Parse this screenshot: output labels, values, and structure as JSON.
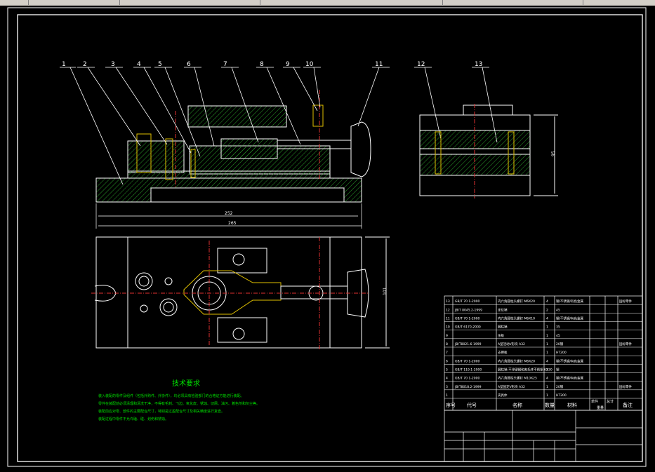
{
  "balloons": [
    "1",
    "2",
    "3",
    "4",
    "5",
    "6",
    "7",
    "8",
    "9",
    "10",
    "11",
    "12",
    "13"
  ],
  "dims": {
    "d1": "252",
    "d2": "265",
    "d3": "95",
    "d4": "101"
  },
  "notes": {
    "title": "技术要求",
    "lines": [
      "装入装配的零件及组件（包括外购件、外协件），均必须具有检验部门的合格证方能进行装配。",
      "零件在装配前必须清理和清洗干净，不得有毛刺、飞边、氧化皮、锈蚀、切屑、油污、着色剂和灰尘等。",
      "装配前应对零、部件的主要配合尺寸，特别是过盈配合尺寸及相关精度进行复查。",
      "装配过程中零件不允许磕、碰、划伤和锈蚀。"
    ]
  },
  "bom": {
    "rows": [
      {
        "seq": "13",
        "code": "GB/T 70 1-2000",
        "name": "内六角圆柱头螺钉 M6X20",
        "qty": "4",
        "mat": "钢/不锈钢/有色金属",
        "note": "国标零件"
      },
      {
        "seq": "12",
        "code": "JB/T 8045.2-1999",
        "name": "定位销",
        "qty": "2",
        "mat": "45",
        "note": ""
      },
      {
        "seq": "11",
        "code": "GB/T 70 1-2000",
        "name": "内六角圆柱头螺钉 M6X10",
        "qty": "4",
        "mat": "钢/不锈钢/有色金属",
        "note": ""
      },
      {
        "seq": "10",
        "code": "GB/T 6170-2000",
        "name": "圆柱销",
        "qty": "1",
        "mat": "35",
        "note": ""
      },
      {
        "seq": "9",
        "code": "",
        "name": "压板",
        "qty": "1",
        "mat": "45",
        "note": ""
      },
      {
        "seq": "8",
        "code": "JB/T8021.6-1999",
        "name": "A型活动V形块 A32",
        "qty": "1",
        "mat": "20钢",
        "note": "国标零件"
      },
      {
        "seq": "7",
        "code": "",
        "name": "支撑板",
        "qty": "1",
        "mat": "HT200",
        "note": ""
      },
      {
        "seq": "6",
        "code": "GB/T 70 1-2000",
        "name": "内六角圆柱头螺钉 M6X20",
        "qty": "4",
        "mat": "钢/不锈钢/有色金属",
        "note": ""
      },
      {
        "seq": "5",
        "code": "GB/T 119.1-2000",
        "name": "圆柱销-不淬硬钢和奥氏体不锈钢 6X30",
        "qty": "2",
        "mat": "钢",
        "note": ""
      },
      {
        "seq": "4",
        "code": "GB/T 70 1-2000",
        "name": "内六角圆柱头螺钉 M10X25",
        "qty": "4",
        "mat": "钢/不锈钢/有色金属",
        "note": ""
      },
      {
        "seq": "3",
        "code": "JB/T8018.2-1999",
        "name": "A型固定V形块 A32",
        "qty": "1",
        "mat": "20钢",
        "note": "国标零件"
      },
      {
        "seq": "1",
        "code": "",
        "name": "夹具体",
        "qty": "1",
        "mat": "HT200",
        "note": ""
      }
    ],
    "headers": {
      "seq": "序号",
      "code": "代号",
      "name": "名称",
      "qty": "数量",
      "mat": "材料",
      "unit": "单件",
      "total": "总计",
      "mass": "重量",
      "note": "备注"
    }
  }
}
